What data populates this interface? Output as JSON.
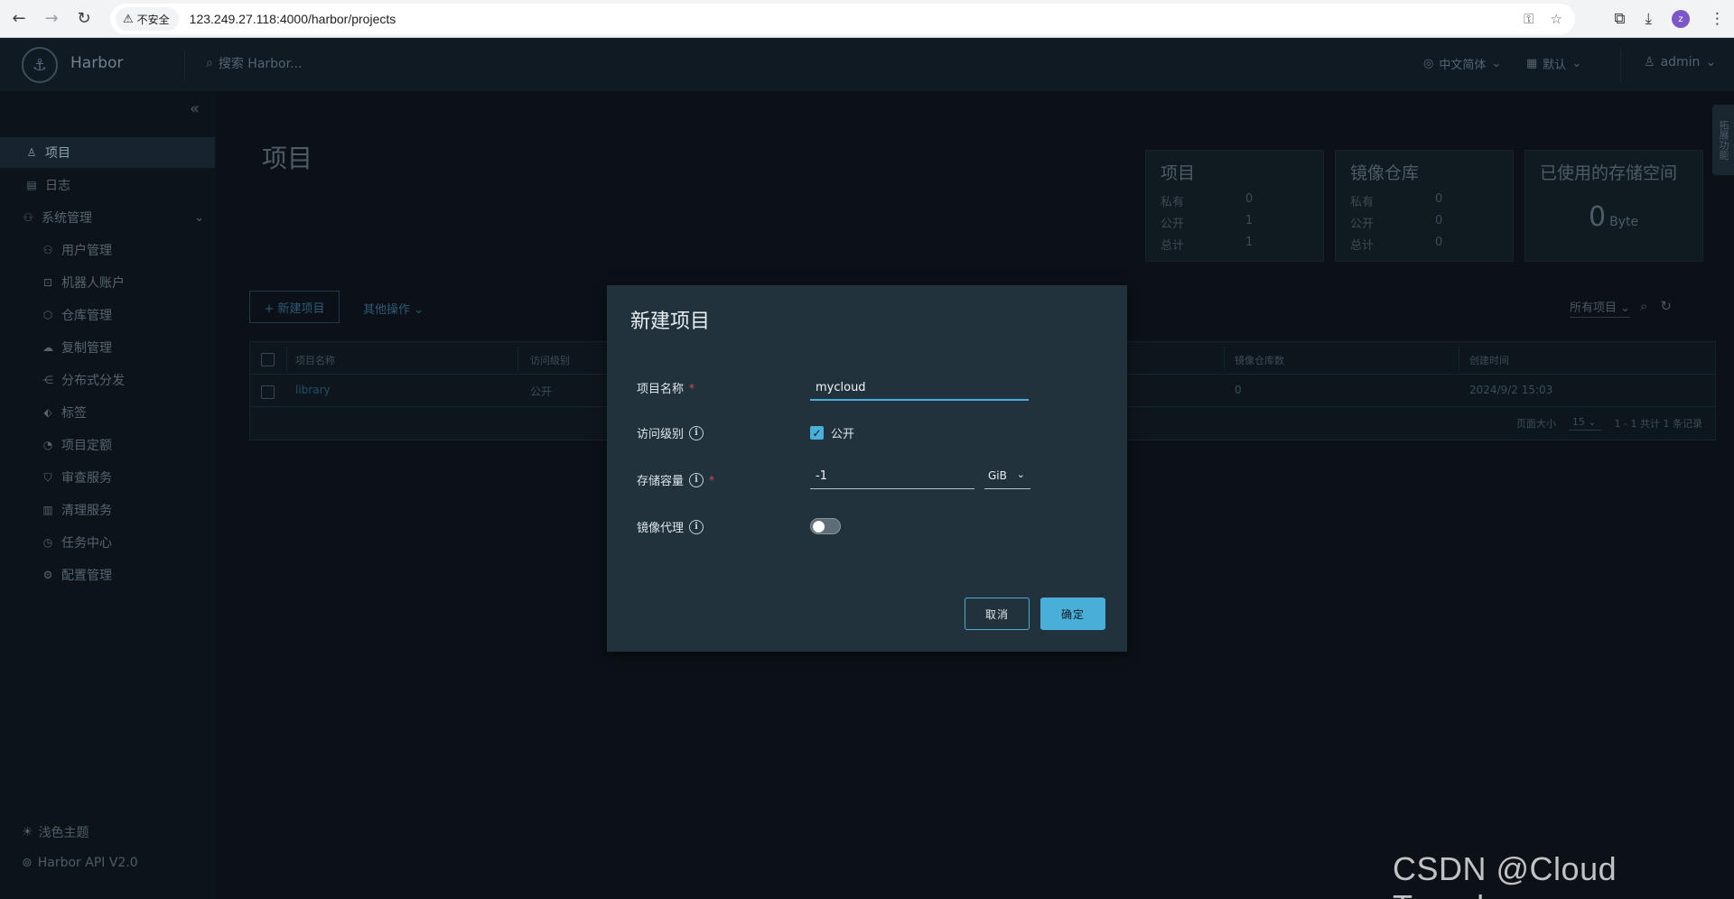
{
  "browser": {
    "security_label": "不安全",
    "url": "123.249.27.118:4000/harbor/projects",
    "profile_initial": "z"
  },
  "header": {
    "brand": "Harbor",
    "search_placeholder": "搜索 Harbor...",
    "language": "中文简体",
    "theme": "默认",
    "user": "admin"
  },
  "sidebar": {
    "items": [
      {
        "label": "项目",
        "icon": "projects-icon"
      },
      {
        "label": "日志",
        "icon": "logs-icon"
      },
      {
        "label": "系统管理",
        "icon": "admin-icon"
      },
      {
        "label": "用户管理",
        "icon": "users-icon"
      },
      {
        "label": "机器人账户",
        "icon": "robot-icon"
      },
      {
        "label": "仓库管理",
        "icon": "registry-icon"
      },
      {
        "label": "复制管理",
        "icon": "replication-icon"
      },
      {
        "label": "分布式分发",
        "icon": "distribution-icon"
      },
      {
        "label": "标签",
        "icon": "tag-icon"
      },
      {
        "label": "项目定额",
        "icon": "quota-icon"
      },
      {
        "label": "审查服务",
        "icon": "scanner-icon"
      },
      {
        "label": "清理服务",
        "icon": "cleanup-icon"
      },
      {
        "label": "任务中心",
        "icon": "jobs-icon"
      },
      {
        "label": "配置管理",
        "icon": "config-icon"
      }
    ],
    "theme_toggle": "浅色主题",
    "api_link": "Harbor API V2.0"
  },
  "main": {
    "title": "项目",
    "cards": {
      "projects": {
        "title": "项目",
        "private_label": "私有",
        "private": "0",
        "public_label": "公开",
        "public": "1",
        "total_label": "总计",
        "total": "1"
      },
      "repos": {
        "title": "镜像仓库",
        "private_label": "私有",
        "private": "0",
        "public_label": "公开",
        "public": "0",
        "total_label": "总计",
        "total": "0"
      },
      "storage": {
        "title": "已使用的存储空间",
        "value": "0",
        "unit": "Byte"
      }
    },
    "new_project_button": "+ 新建项目",
    "more_actions": "其他操作",
    "filter": "所有项目",
    "side_tab": "拓展功能",
    "table": {
      "headers": [
        "项目名称",
        "访问级别",
        "镜像仓库数",
        "创建时间"
      ],
      "rows": [
        {
          "name": "library",
          "access": "公开",
          "repo_count": "0",
          "created": "2024/9/2 15:03"
        }
      ],
      "page_size_label": "页面大小",
      "page_size": "15",
      "summary": "1 - 1 共计 1 条记录"
    }
  },
  "modal": {
    "title": "新建项目",
    "name_label": "项目名称",
    "name_value": "mycloud",
    "access_label": "访问级别",
    "public_label": "公开",
    "storage_label": "存储容量",
    "storage_value": "-1",
    "storage_unit": "GiB",
    "proxy_label": "镜像代理",
    "cancel": "取消",
    "ok": "确定"
  },
  "watermark": "CSDN @Cloud Traveler"
}
